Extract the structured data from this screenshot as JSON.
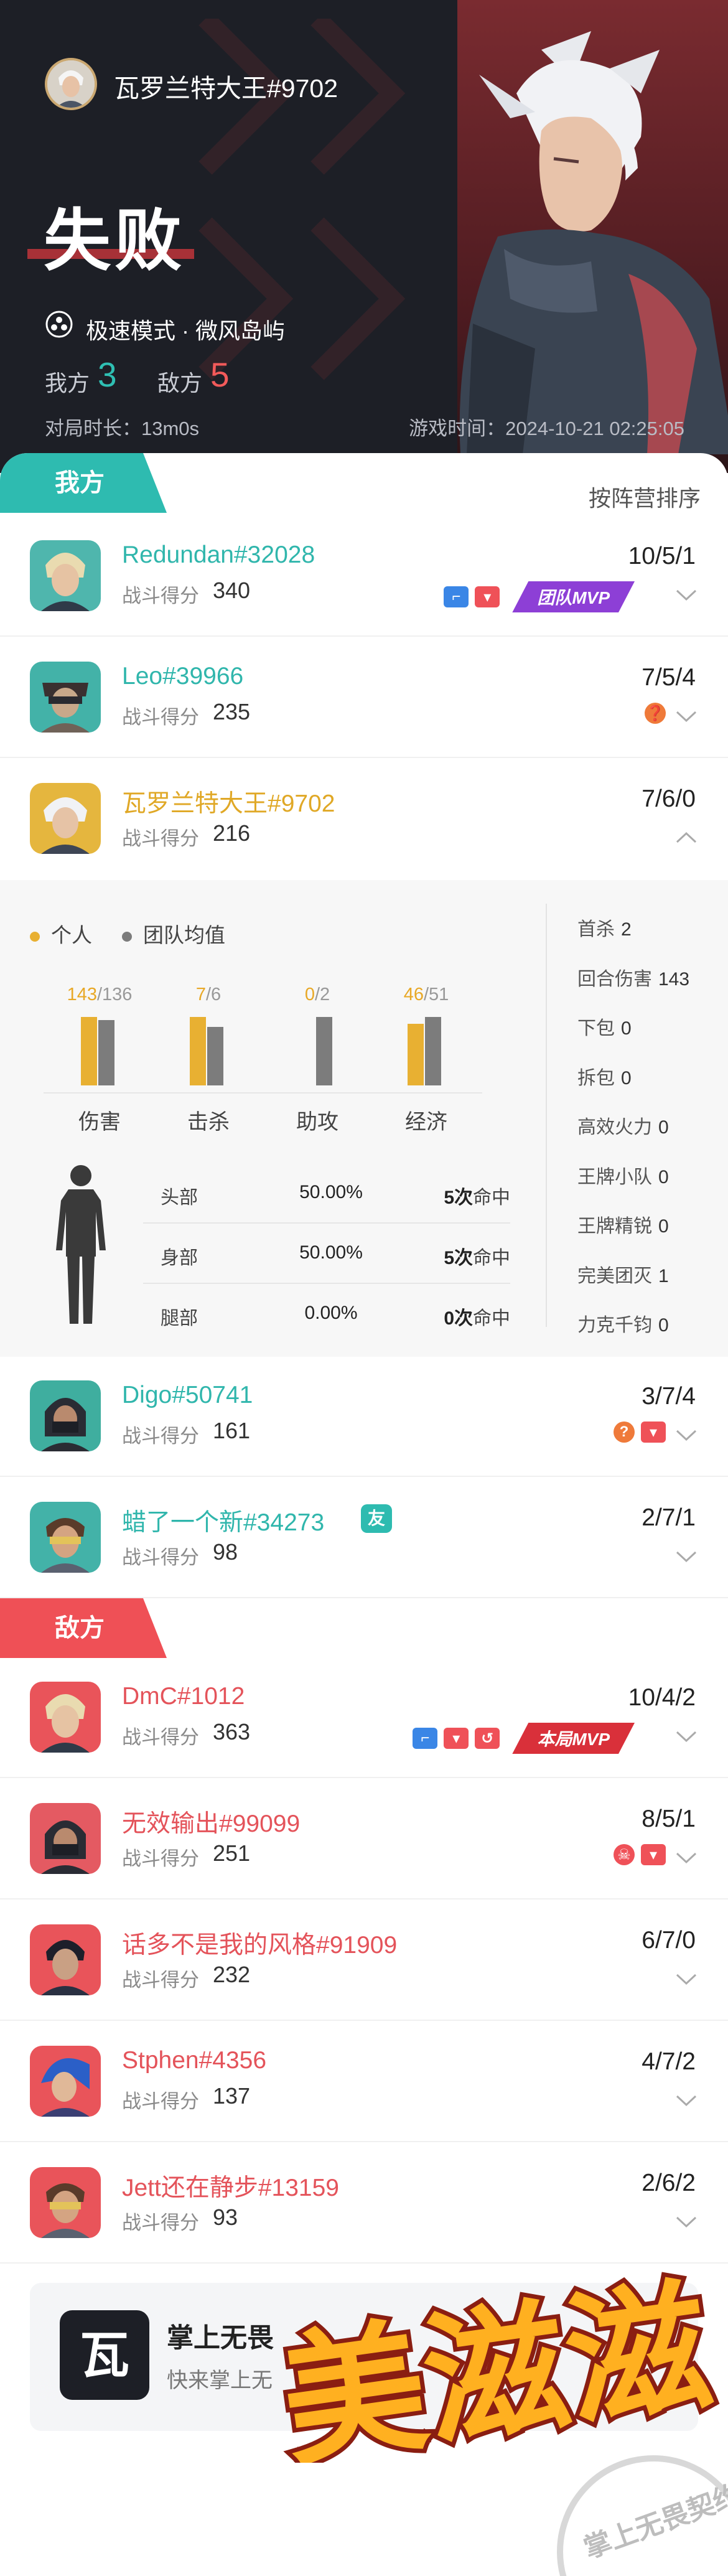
{
  "header": {
    "player_name": "瓦罗兰特大王#9702",
    "result": "失败",
    "mode": "极速模式 · 微风岛屿",
    "score_us_label": "我方",
    "score_us": "3",
    "score_enemy_label": "敌方",
    "score_enemy": "5",
    "duration": "对局时长：13m0s",
    "game_time": "游戏时间：2024-10-21 02:25:05"
  },
  "teams": {
    "us_label": "我方",
    "enemy_label": "敌方",
    "sort_label": "按阵营排序",
    "score_label": "战斗得分"
  },
  "ally_players": [
    {
      "name": "Redundan#32028",
      "score": "340",
      "kda": "10/5/1",
      "mvp": "团队MVP"
    },
    {
      "name": "Leo#39966",
      "score": "235",
      "kda": "7/5/4"
    },
    {
      "name": "瓦罗兰特大王#9702",
      "score": "216",
      "kda": "7/6/0"
    },
    {
      "name": "Digo#50741",
      "score": "161",
      "kda": "3/7/4"
    },
    {
      "name": "蜡了一个新#34273",
      "score": "98",
      "kda": "2/7/1",
      "tag": "友"
    }
  ],
  "enemy_players": [
    {
      "name": "DmC#1012",
      "score": "363",
      "kda": "10/4/2",
      "mvp": "本局MVP"
    },
    {
      "name": "无效输出#99099",
      "score": "251",
      "kda": "8/5/1"
    },
    {
      "name": "话多不是我的风格#91909",
      "score": "232",
      "kda": "6/7/0"
    },
    {
      "name": "Stphen#4356",
      "score": "137",
      "kda": "4/7/2"
    },
    {
      "name": "Jett还在静步#13159",
      "score": "93",
      "kda": "2/6/2"
    }
  ],
  "detail": {
    "legend_personal": "个人",
    "legend_team": "团队均值",
    "colors": {
      "personal": "#e8b032",
      "team": "#7c7c7c"
    },
    "chart_data": {
      "type": "bar",
      "categories": [
        "伤害",
        "击杀",
        "助攻",
        "经济"
      ],
      "series": [
        {
          "name": "个人",
          "values": [
            143,
            7,
            0,
            46
          ]
        },
        {
          "name": "团队均值",
          "values": [
            136,
            6,
            2,
            51
          ]
        }
      ],
      "value_labels": [
        {
          "mine": "143",
          "avg": "/136"
        },
        {
          "mine": "7",
          "avg": "/6"
        },
        {
          "mine": "0",
          "avg": "/2"
        },
        {
          "mine": "46",
          "avg": "/51"
        }
      ]
    },
    "hits": [
      {
        "part": "头部",
        "pct": "50.00%",
        "count": "5次",
        "suffix": "命中"
      },
      {
        "part": "身部",
        "pct": "50.00%",
        "count": "5次",
        "suffix": "命中"
      },
      {
        "part": "腿部",
        "pct": "0.00%",
        "count": "0次",
        "suffix": "命中"
      }
    ],
    "stats": [
      {
        "label": "首杀",
        "value": "2"
      },
      {
        "label": "回合伤害",
        "value": "143"
      },
      {
        "label": "下包",
        "value": "0"
      },
      {
        "label": "拆包",
        "value": "0"
      },
      {
        "label": "高效火力",
        "value": "0"
      },
      {
        "label": "王牌小队",
        "value": "0"
      },
      {
        "label": "王牌精锐",
        "value": "0"
      },
      {
        "label": "完美团灭",
        "value": "1"
      },
      {
        "label": "力克千钧",
        "value": "0"
      }
    ]
  },
  "footer": {
    "app_title": "掌上无畏",
    "app_sub": "快来掌上无",
    "icon_char": "瓦",
    "sticker_text": "美滋滋",
    "watermark": "掌上无畏契约"
  }
}
